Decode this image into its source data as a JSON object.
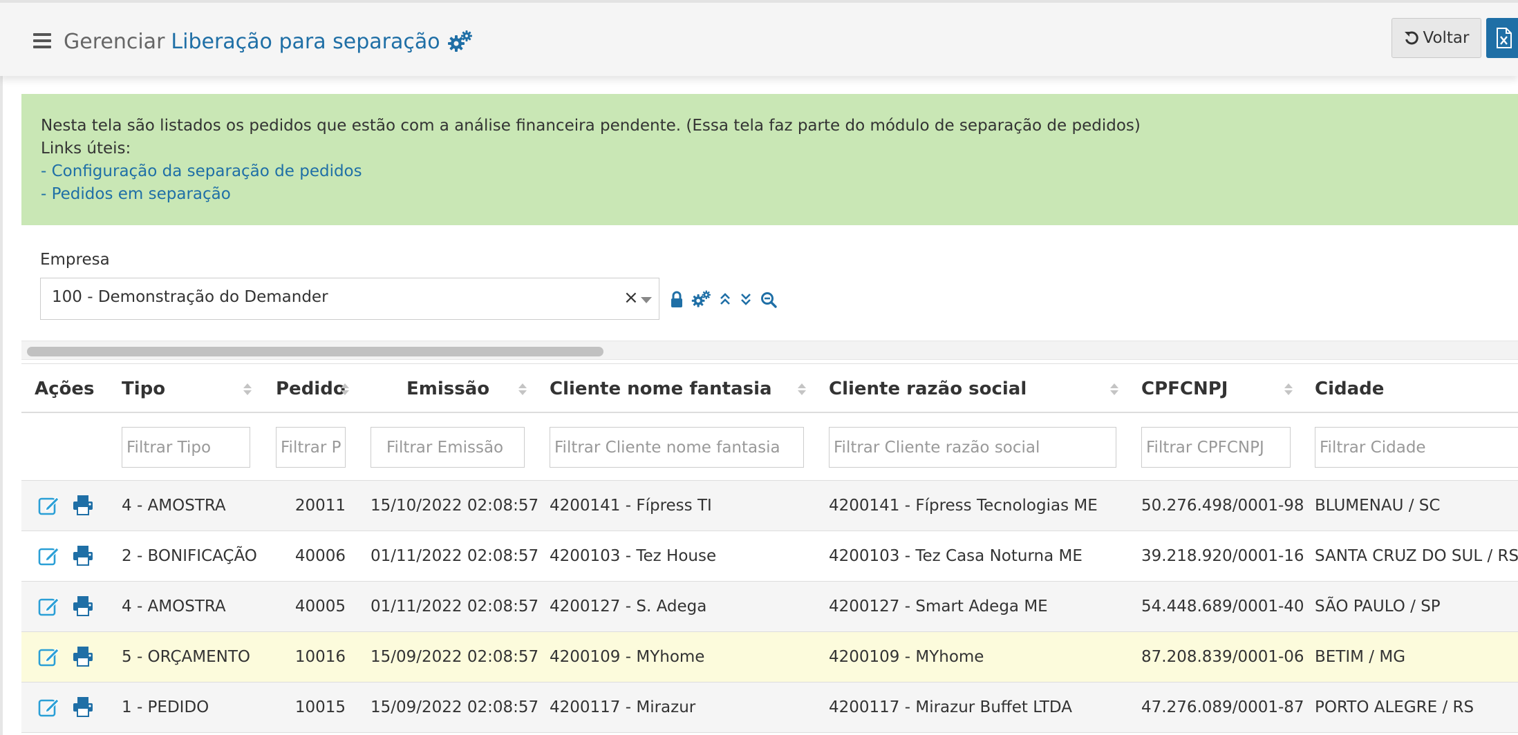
{
  "header": {
    "title_prefix": "Gerenciar",
    "title_main": "Liberação para separação",
    "back_label": "Voltar",
    "icons": [
      "menu-icon",
      "gears-icon",
      "undo-icon",
      "excel-file-icon"
    ]
  },
  "info": {
    "description": "Nesta tela são listados os pedidos que estão com a análise financeira pendente. (Essa tela faz parte do módulo de separação de pedidos)",
    "links_label": "Links úteis:",
    "links": [
      "- Configuração da separação de pedidos",
      "- Pedidos em separação"
    ]
  },
  "filter": {
    "label": "Empresa",
    "selected": "100 - Demonstração do Demander",
    "clear": "×",
    "tool_icons": [
      "lock-icon",
      "gears-icon",
      "collapse-icon",
      "expand-icon",
      "zoom-out-icon"
    ]
  },
  "table": {
    "columns": [
      "Ações",
      "Tipo",
      "Pedido",
      "Emissão",
      "Cliente nome fantasia",
      "Cliente razão social",
      "CPFCNPJ",
      "Cidade"
    ],
    "placeholders": [
      "Filtrar Tipo",
      "Filtrar Pedido",
      "Filtrar Emissão",
      "Filtrar Cliente nome fantasia",
      "Filtrar Cliente razão social",
      "Filtrar CPFCNPJ",
      "Filtrar Cidade"
    ],
    "row_icons": [
      "edit-icon",
      "print-icon"
    ],
    "rows": [
      {
        "tipo": "4 - AMOSTRA",
        "pedido": "20011",
        "emissao": "15/10/2022 02:08:57",
        "fantasia": "4200141 - Fípress TI",
        "razao": "4200141 - Fípress Tecnologias ME",
        "cnpj": "50.276.498/0001-98",
        "cidade": "BLUMENAU / SC",
        "highlight": false
      },
      {
        "tipo": "2 - BONIFICAÇÃO",
        "pedido": "40006",
        "emissao": "01/11/2022 02:08:57",
        "fantasia": "4200103 - Tez House",
        "razao": "4200103 - Tez Casa Noturna ME",
        "cnpj": "39.218.920/0001-16",
        "cidade": "SANTA CRUZ DO SUL / RS",
        "highlight": false
      },
      {
        "tipo": "4 - AMOSTRA",
        "pedido": "40005",
        "emissao": "01/11/2022 02:08:57",
        "fantasia": "4200127 - S. Adega",
        "razao": "4200127 - Smart Adega ME",
        "cnpj": "54.448.689/0001-40",
        "cidade": "SÃO PAULO / SP",
        "highlight": false
      },
      {
        "tipo": "5 - ORÇAMENTO",
        "pedido": "10016",
        "emissao": "15/09/2022 02:08:57",
        "fantasia": "4200109 - MYhome",
        "razao": "4200109 - MYhome",
        "cnpj": "87.208.839/0001-06",
        "cidade": "BETIM / MG",
        "highlight": true
      },
      {
        "tipo": "1 - PEDIDO",
        "pedido": "10015",
        "emissao": "15/09/2022 02:08:57",
        "fantasia": "4200117 - Mirazur",
        "razao": "4200117 - Mirazur Buffet LTDA",
        "cnpj": "47.276.089/0001-87",
        "cidade": "PORTO ALEGRE / RS",
        "highlight": false
      }
    ]
  },
  "colors": {
    "primary": "#1f6fa6",
    "info_bg": "#c9e7b5",
    "row_highlight": "#fcfbdc",
    "row_stripe": "#f5f5f5"
  }
}
